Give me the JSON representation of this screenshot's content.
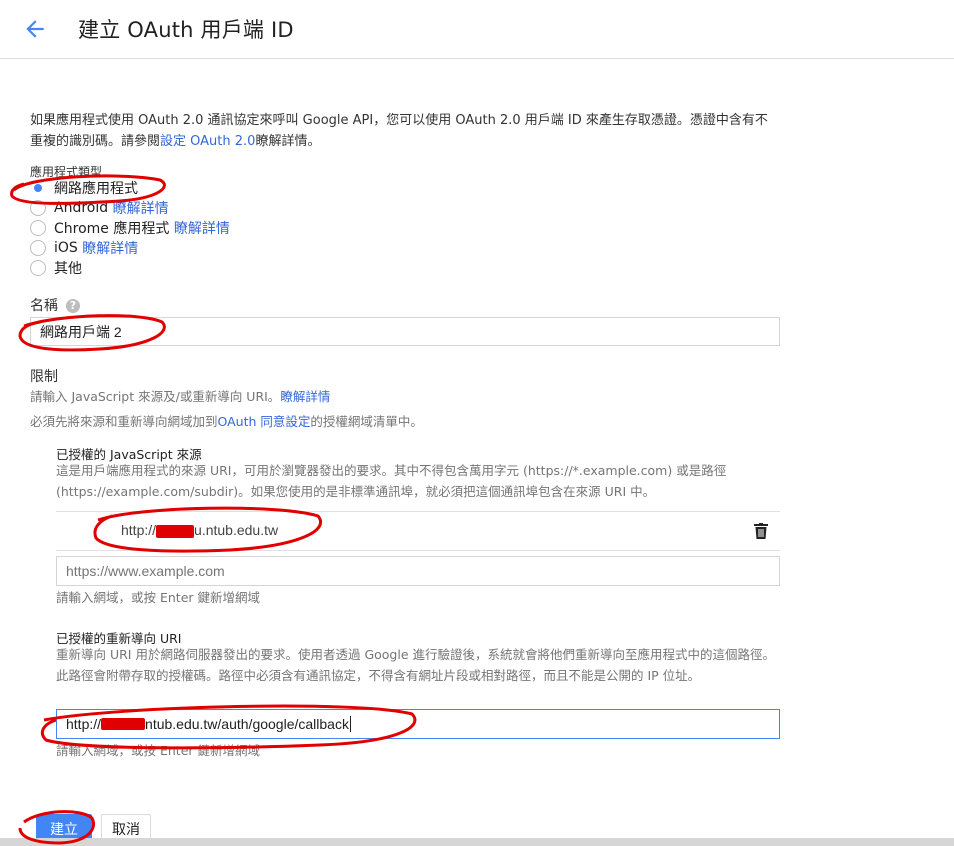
{
  "header": {
    "title": "建立 OAuth 用戶端 ID"
  },
  "intro": {
    "text": "如果應用程式使用 OAuth 2.0 通訊協定來呼叫 Google API，您可以使用 OAuth 2.0 用戶端 ID 來產生存取憑證。憑證中含有不重複的識別碼。請參閱",
    "link": "設定 OAuth 2.0",
    "suffix": "瞭解詳情。"
  },
  "app_type": {
    "label": "應用程式類型",
    "options": [
      {
        "label": "網路應用程式",
        "link": "",
        "checked": true
      },
      {
        "label": "Android",
        "link": "瞭解詳情",
        "checked": false
      },
      {
        "label": "Chrome 應用程式",
        "link": "瞭解詳情",
        "checked": false
      },
      {
        "label": "iOS",
        "link": "瞭解詳情",
        "checked": false
      },
      {
        "label": "其他",
        "link": "",
        "checked": false
      }
    ]
  },
  "name": {
    "label": "名稱",
    "value": "網路用戶端 2"
  },
  "restrictions": {
    "title": "限制",
    "line1": "請輸入 JavaScript 來源及/或重新導向 URI。",
    "line1_link": "瞭解詳情",
    "line2_prefix": "必須先將來源和重新導向網域加到",
    "line2_link": "OAuth 同意設定",
    "line2_suffix": "的授權網域清單中。"
  },
  "js_origins": {
    "title": "已授權的 JavaScript 來源",
    "description": "這是用戶端應用程式的來源 URI，可用於瀏覽器發出的要求。其中不得包含萬用字元 (https://*.example.com) 或是路徑 (https://example.com/subdir)。如果您使用的是非標準通訊埠，就必須把這個通訊埠包含在來源 URI 中。",
    "entry": "http://",
    "entry_suffix": "u.ntub.edu.tw",
    "placeholder": "https://www.example.com",
    "hint": "請輸入網域，或按 Enter 鍵新增網域"
  },
  "redirect_uris": {
    "title": "已授權的重新導向 URI",
    "description": "重新導向 URI 用於網路伺服器發出的要求。使用者透過 Google 進行驗證後，系統就會將他們重新導向至應用程式中的這個路徑。此路徑會附帶存取的授權碼。路徑中必須含有通訊協定，不得含有網址片段或相對路徑，而且不能是公開的 IP 位址。",
    "value_prefix": "http://",
    "value_suffix": "ntub.edu.tw/auth/google/callback",
    "hint": "請輸入網域，或按 Enter 鍵新增網域"
  },
  "buttons": {
    "create": "建立",
    "cancel": "取消"
  },
  "colors": {
    "accent": "#4285f4",
    "link": "#3367d6",
    "annotation": "#e00000"
  }
}
